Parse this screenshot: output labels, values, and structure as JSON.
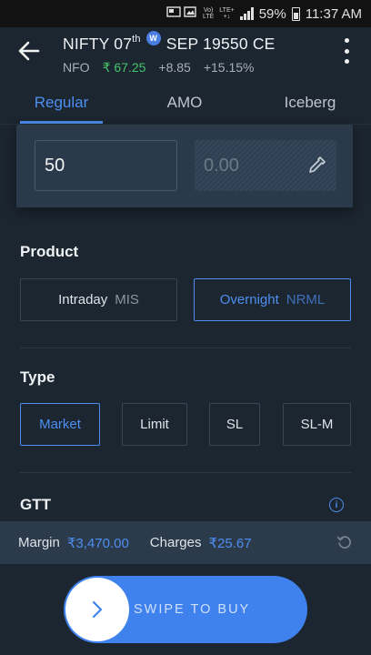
{
  "status_bar": {
    "network_tag_top": "Vo)",
    "network_tag_bottom": "LTE",
    "lte_tag_top": "LTE+",
    "lte_tag_bottom": "+↓",
    "battery": "59%",
    "time": "11:37 AM"
  },
  "header": {
    "symbol": "NIFTY 07",
    "symbol_sup": "th",
    "weekly_badge": "W",
    "contract": "SEP 19550 CE",
    "exchange": "NFO",
    "ltp": "₹ 67.25",
    "change": "+8.85",
    "change_pct": "+15.15%",
    "ltp_color": "#46c26b"
  },
  "tabs": [
    {
      "label": "Regular",
      "active": true
    },
    {
      "label": "AMO",
      "active": false
    },
    {
      "label": "Iceberg",
      "active": false
    }
  ],
  "order": {
    "quantity": "50",
    "price_placeholder": "0.00"
  },
  "product": {
    "title": "Product",
    "options": [
      {
        "label": "Intraday",
        "code": "MIS",
        "selected": false
      },
      {
        "label": "Overnight",
        "code": "NRML",
        "selected": true
      }
    ]
  },
  "type": {
    "title": "Type",
    "options": [
      {
        "label": "Market",
        "selected": true
      },
      {
        "label": "Limit",
        "selected": false
      },
      {
        "label": "SL",
        "selected": false
      },
      {
        "label": "SL-M",
        "selected": false
      }
    ]
  },
  "gtt": {
    "title": "GTT",
    "info_icon": "info-icon"
  },
  "summary": {
    "margin_label": "Margin",
    "margin_value": "₹3,470.00",
    "charges_label": "Charges",
    "charges_value": "₹25.67"
  },
  "action": {
    "swipe_label": "SWIPE TO BUY",
    "accent": "#3f82ed"
  }
}
